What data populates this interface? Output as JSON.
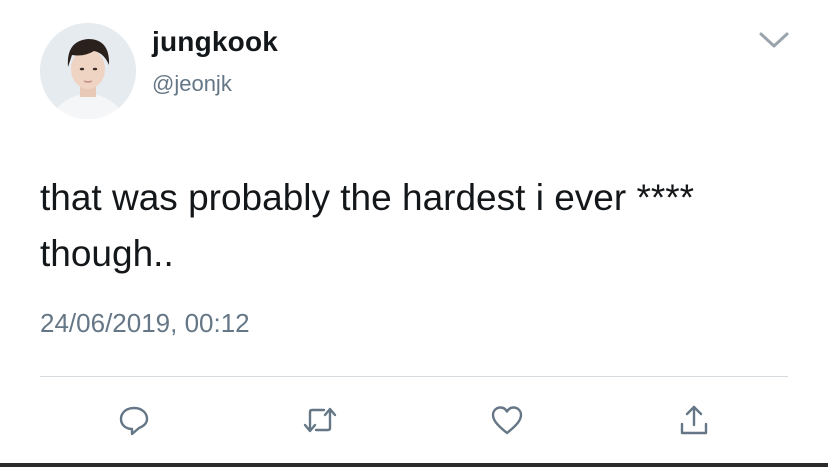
{
  "tweet": {
    "display_name": "jungkook",
    "handle": "@jeonjk",
    "text_line1": "that was probably the hardest i ever ****",
    "text_line2": "though..",
    "timestamp": "24/06/2019, 00:12"
  },
  "icons": {
    "menu": "chevron-down-icon",
    "reply": "reply-bubble-icon",
    "retweet": "retweet-icon",
    "like": "heart-icon",
    "share": "share-upload-icon"
  },
  "colors": {
    "text_primary": "#14171a",
    "text_secondary": "#657786",
    "divider": "#d6dbe0",
    "icon": "#657786"
  }
}
